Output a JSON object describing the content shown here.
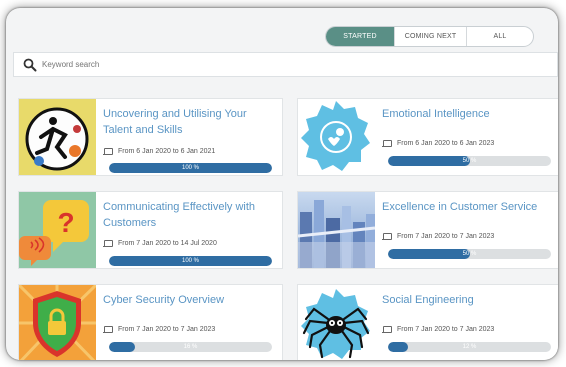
{
  "tabs": [
    {
      "label": "STARTED",
      "active": true
    },
    {
      "label": "COMING NEXT",
      "active": false
    },
    {
      "label": "ALL",
      "active": false
    }
  ],
  "search": {
    "placeholder": "Keyword search",
    "icon": "search-icon"
  },
  "courses": [
    {
      "title": "Uncovering and Utilising Your Talent and Skills",
      "dates": "From 6 Jan 2020 to 6 Jan 2021",
      "progress": 100,
      "progress_label": "100 %",
      "icon": "talent-sports-icon"
    },
    {
      "title": "Emotional Intelligence",
      "dates": "From 6 Jan 2020 to 6 Jan 2023",
      "progress": 50,
      "progress_label": "50 %",
      "icon": "emotional-intelligence-badge-icon"
    },
    {
      "title": "Communicating Effectively with Customers",
      "dates": "From 7 Jan 2020 to 14 Jul 2020",
      "progress": 100,
      "progress_label": "100 %",
      "icon": "speech-bubble-question-icon"
    },
    {
      "title": "Excellence in Customer Service",
      "dates": "From 7 Jan 2020 to 7 Jan 2023",
      "progress": 50,
      "progress_label": "50 %",
      "icon": "cityscape-photo"
    },
    {
      "title": "Cyber Security Overview",
      "dates": "From 7 Jan 2020 to 7 Jan 2023",
      "progress": 16,
      "progress_label": "16 %",
      "icon": "shield-lock-icon"
    },
    {
      "title": "Social Engineering",
      "dates": "From 7 Jan 2020 to 7 Jan 2023",
      "progress": 12,
      "progress_label": "12 %",
      "icon": "spider-icon"
    }
  ],
  "colors": {
    "accent": "#5a8f86",
    "progress_fill": "#2f6da3",
    "title": "#5a95c4"
  }
}
